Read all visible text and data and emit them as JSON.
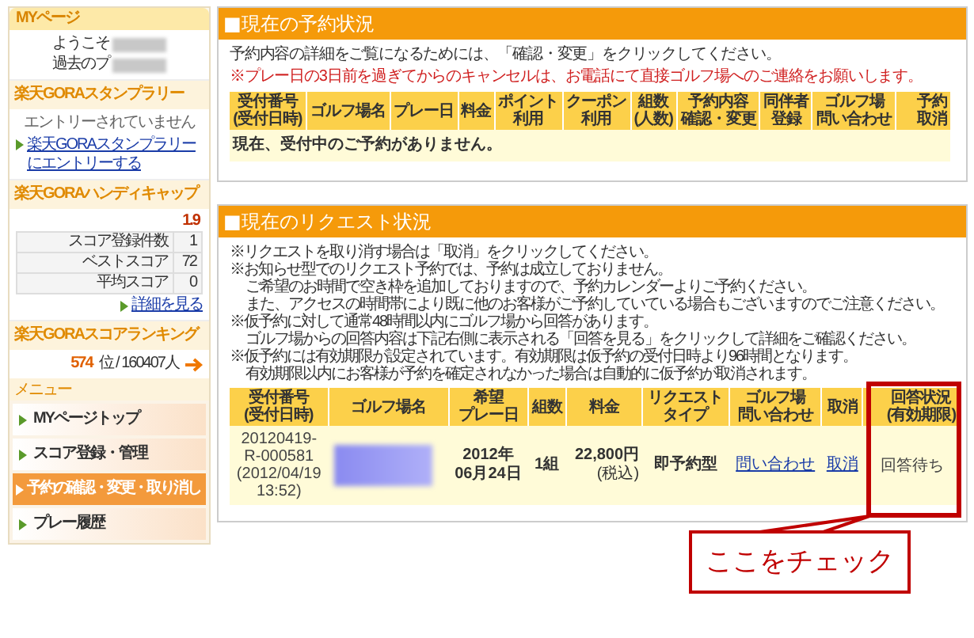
{
  "sidebar": {
    "title": "MYページ",
    "welcome": [
      "ようこそ",
      "過去のプ"
    ],
    "stamp_rally": {
      "title": "楽天GORAスタンプラリー",
      "status": "エントリーされていません",
      "link": "楽天GORAスタンプラリーにエントリーする"
    },
    "handicap": {
      "title": "楽天GORAハンディキャップ",
      "value": "1.9",
      "stats": [
        {
          "label": "スコア登録件数",
          "value": "1"
        },
        {
          "label": "ベストスコア",
          "value": "72"
        },
        {
          "label": "平均スコア",
          "value": "0"
        }
      ],
      "link": "詳細を見る"
    },
    "ranking": {
      "title": "楽天GORAスコアランキング",
      "rank": "574",
      "rest": "位 / 160407人"
    },
    "menu": {
      "title": "メニュー",
      "items": [
        {
          "label": "MYページトップ",
          "selected": false
        },
        {
          "label": "スコア登録・管理",
          "selected": false
        },
        {
          "label": "予約の確認・変更・取り消し",
          "selected": true
        },
        {
          "label": "プレー履歴",
          "selected": false
        }
      ]
    }
  },
  "reservations": {
    "title": "■現在の予約状況",
    "notes": [
      {
        "text": "予約内容の詳細をご覧になるためには、「確認・変更」をクリックしてください。",
        "warning": false
      },
      {
        "text": "※プレー日の3日前を過ぎてからのキャンセルは、お電話にて直接ゴルフ場へのご連絡をお願いします。",
        "warning": true
      }
    ],
    "columns": [
      {
        "lines": [
          "受付番号",
          "(受付日時)"
        ]
      },
      {
        "lines": [
          "ゴルフ場名"
        ]
      },
      {
        "lines": [
          "プレー日"
        ]
      },
      {
        "lines": [
          "料金"
        ]
      },
      {
        "lines": [
          "ポイント",
          "利用"
        ]
      },
      {
        "lines": [
          "クーポン",
          "利用"
        ]
      },
      {
        "lines": [
          "組数",
          "(人数)"
        ]
      },
      {
        "lines": [
          "予約内容",
          "確認・変更"
        ]
      },
      {
        "lines": [
          "同伴者",
          "登録"
        ]
      },
      {
        "lines": [
          "ゴルフ場",
          "問い合わせ"
        ]
      },
      {
        "lines": [
          "予約",
          "取消"
        ]
      }
    ],
    "empty_message": "現在、受付中のご予約がありません。"
  },
  "requests": {
    "title": "■現在のリクエスト状況",
    "notes": [
      {
        "text": "※リクエストを取り消す場合は「取消」をクリックしてください。",
        "indent": false
      },
      {
        "text": "※お知らせ型でのリクエスト予約では、予約は成立しておりません。",
        "indent": false
      },
      {
        "text": "ご希望のお時間で空き枠を追加しておりますので、予約カレンダーよりご予約ください。",
        "indent": true
      },
      {
        "text": "また、アクセスの時間帯により既に他のお客様がご予約していている場合もございますのでご注意ください。",
        "indent": true
      },
      {
        "text": "※仮予約に対して通常48時間以内にゴルフ場から回答があります。",
        "indent": false
      },
      {
        "text": "ゴルフ場からの回答内容は下記右側に表示される「回答を見る」をクリックして詳細をご確認ください。",
        "indent": true
      },
      {
        "text": "※仮予約には有効期限が設定されています。有効期限は仮予約の受付日時より96時間となります。",
        "indent": false
      },
      {
        "text": "有効期限以内にお客様が予約を確定されなかった場合は自動的に仮予約が取消されます。",
        "indent": true
      }
    ],
    "columns": [
      {
        "lines": [
          "受付番号",
          "(受付日時)"
        ]
      },
      {
        "lines": [
          "ゴルフ場名"
        ]
      },
      {
        "lines": [
          "希望",
          "プレー日"
        ]
      },
      {
        "lines": [
          "組数"
        ]
      },
      {
        "lines": [
          "料金"
        ]
      },
      {
        "lines": [
          "リクエスト",
          "タイプ"
        ]
      },
      {
        "lines": [
          "ゴルフ場",
          "問い合わせ"
        ]
      },
      {
        "lines": [
          "取消"
        ]
      },
      {
        "lines": [
          "回答状況",
          "(有効期限)"
        ]
      }
    ],
    "rows": [
      {
        "cells": [
          {
            "kind": "text",
            "text": "20120419-\nR-000581\n(2012/04/19\n13:52)"
          },
          {
            "kind": "blurred"
          },
          {
            "kind": "bold",
            "text": "2012年\n06月24日"
          },
          {
            "kind": "bold",
            "text": "1組"
          },
          {
            "kind": "price",
            "text": "22,800円",
            "sub": "(税込)"
          },
          {
            "kind": "bold",
            "text": "即予約型"
          },
          {
            "kind": "link",
            "text": "問い合わせ"
          },
          {
            "kind": "link",
            "text": "取消"
          },
          {
            "kind": "text",
            "text": "回答待ち"
          }
        ]
      }
    ]
  },
  "callout": {
    "text": "ここをチェック"
  }
}
